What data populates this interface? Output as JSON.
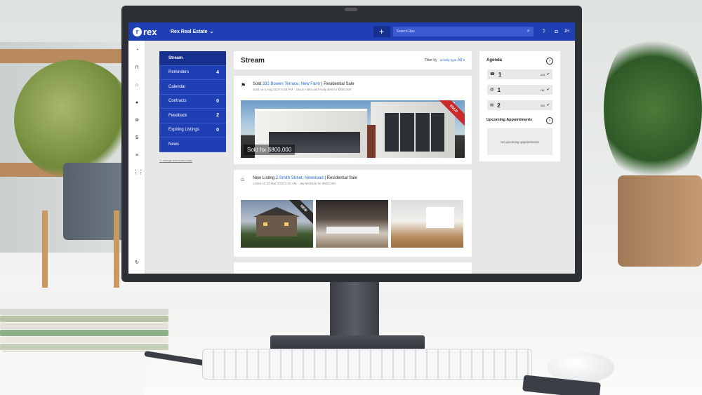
{
  "app": {
    "logo_text": "rex",
    "brand": "Rex Real Estate",
    "search_placeholder": "Search Rex",
    "user_initials": "JH"
  },
  "menu": [
    {
      "label": "Stream",
      "count": ""
    },
    {
      "label": "Reminders",
      "count": "4"
    },
    {
      "label": "Calendar",
      "count": ""
    },
    {
      "label": "Contracts",
      "count": "0"
    },
    {
      "label": "Feedback",
      "count": "2"
    },
    {
      "label": "Expiring Listings",
      "count": "0"
    },
    {
      "label": "News",
      "count": ""
    }
  ],
  "change_dashboard": "change dashboard user",
  "stream": {
    "title": "Stream",
    "filter_label": "Filter by",
    "filter_key": "activity type",
    "filter_value": "All",
    "cards": [
      {
        "prefix": "Sold",
        "address": "332 Bowen Terrace, New Farm",
        "sep": "|",
        "type": "Residential Sale",
        "sub": "Sold on 5 Aug 2020 6:58 PM · Jason Holm and Andy Bell for $800,000",
        "image_label": "Sold for $800,000",
        "ribbon": "SOLD"
      },
      {
        "prefix": "New Listing",
        "address": "2 Smith Street, Newstead",
        "sep": "|",
        "type": "Residential Sale",
        "sub": "Listed on 22 Mar 2018 5:42 AM · Jay McBride for $550,000",
        "ribbon": "NEW"
      }
    ]
  },
  "agenda": {
    "title": "Agenda",
    "rows": [
      {
        "icon": "phone-icon",
        "glyph": "☎",
        "count": "1",
        "fraction": "2/3"
      },
      {
        "icon": "at-icon",
        "glyph": "@",
        "count": "1",
        "fraction": "0/1"
      },
      {
        "icon": "clipboard-icon",
        "glyph": "▤",
        "count": "2",
        "fraction": "0/2"
      }
    ],
    "upcoming_title": "Upcoming Appointments",
    "no_appointments": "No upcoming appointments"
  }
}
